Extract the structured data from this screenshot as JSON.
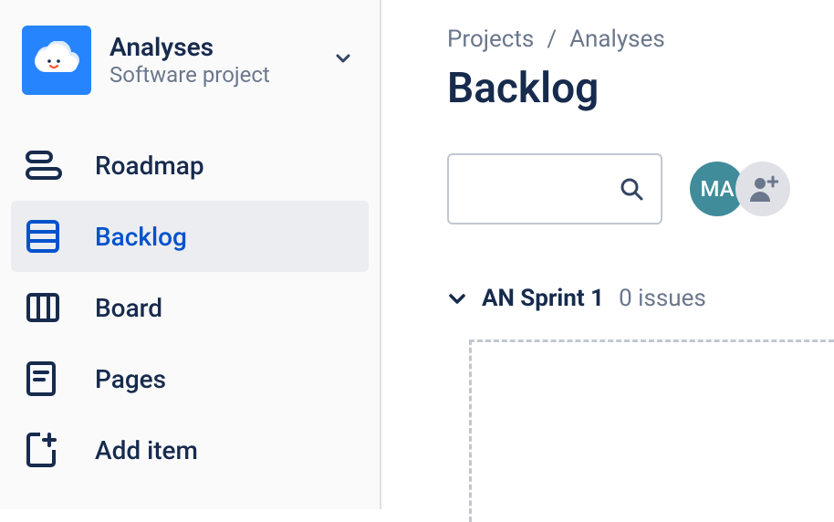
{
  "project": {
    "name": "Analyses",
    "subtitle": "Software project"
  },
  "nav": {
    "roadmap": "Roadmap",
    "backlog": "Backlog",
    "board": "Board",
    "pages": "Pages",
    "add_item": "Add item"
  },
  "breadcrumb": {
    "root": "Projects",
    "sep": "/",
    "current": "Analyses"
  },
  "page": {
    "title": "Backlog"
  },
  "search": {
    "placeholder": ""
  },
  "avatars": {
    "user_initials": "MA"
  },
  "sprint": {
    "name": "AN Sprint 1",
    "count_label": "0 issues"
  }
}
